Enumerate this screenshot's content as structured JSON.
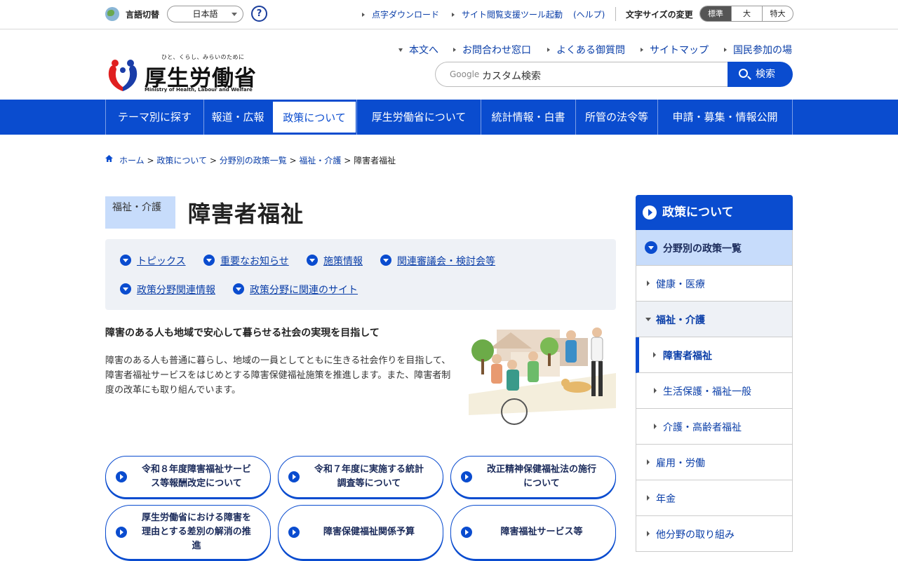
{
  "topbar": {
    "lang_label": "言語切替",
    "lang_value": "日本語",
    "help": "?",
    "braille": "点字ダウンロード",
    "assist_tool": "サイト閲覧支援ツール起動",
    "assist_help": "(ヘルプ)",
    "font_label": "文字サイズの変更",
    "font_sizes": [
      "標準",
      "大",
      "特大"
    ]
  },
  "logo": {
    "tagline": "ひと、くらし、みらいのために",
    "name_jp": "厚生労働省",
    "name_en": "Ministry of Health, Labour and Welfare"
  },
  "header_links": [
    "本文へ",
    "お問合わせ窓口",
    "よくある御質問",
    "サイトマップ",
    "国民参加の場"
  ],
  "search": {
    "google_label": "Google",
    "placeholder": "カスタム検索",
    "button": "検索"
  },
  "global_nav": [
    "テーマ別に探す",
    "報道・広報",
    "政策について",
    "厚生労働省について",
    "統計情報・白書",
    "所管の法令等",
    "申請・募集・情報公開"
  ],
  "breadcrumb": [
    "ホーム",
    "政策について",
    "分野別の政策一覧",
    "福祉・介護",
    "障害者福祉"
  ],
  "page": {
    "category": "福祉・介護",
    "title": "障害者福祉"
  },
  "anchors": [
    "トピックス",
    "重要なお知らせ",
    "施策情報",
    "関連審議会・検討会等",
    "政策分野関連情報",
    "政策分野に関連のサイト"
  ],
  "intro": {
    "heading": "障害のある人も地域で安心して暮らせる社会の実現を目指して",
    "body": "障害のある人も普通に暮らし、地域の一員としてともに生きる社会作りを目指して、障害者福祉サービスをはじめとする障害保健福祉施策を推進します。また、障害者制度の改革にも取り組んでいます。"
  },
  "buttons": [
    [
      "令和８年度障害福祉サービ",
      "ス等報酬改定について"
    ],
    [
      "令和７年度に実施する統計",
      "調査等について"
    ],
    [
      "改正精神保健福祉法の施行",
      "について"
    ],
    [
      "厚生労働省における障害を",
      "理由とする差別の解消の推",
      "進"
    ],
    [
      "障害保健福祉関係予算"
    ],
    [
      "障害福祉サービス等"
    ]
  ],
  "side_nav": {
    "head": "政策について",
    "section": "分野別の政策一覧",
    "items": [
      "健康・医療",
      "福祉・介護",
      "障害者福祉",
      "生活保護・福祉一般",
      "介護・高齢者福祉",
      "雇用・労働",
      "年金",
      "他分野の取り組み"
    ]
  },
  "colors": {
    "brand_blue": "#0a4ccf",
    "light_blue": "#c7dcfb",
    "panel_gray": "#eef1f6"
  }
}
